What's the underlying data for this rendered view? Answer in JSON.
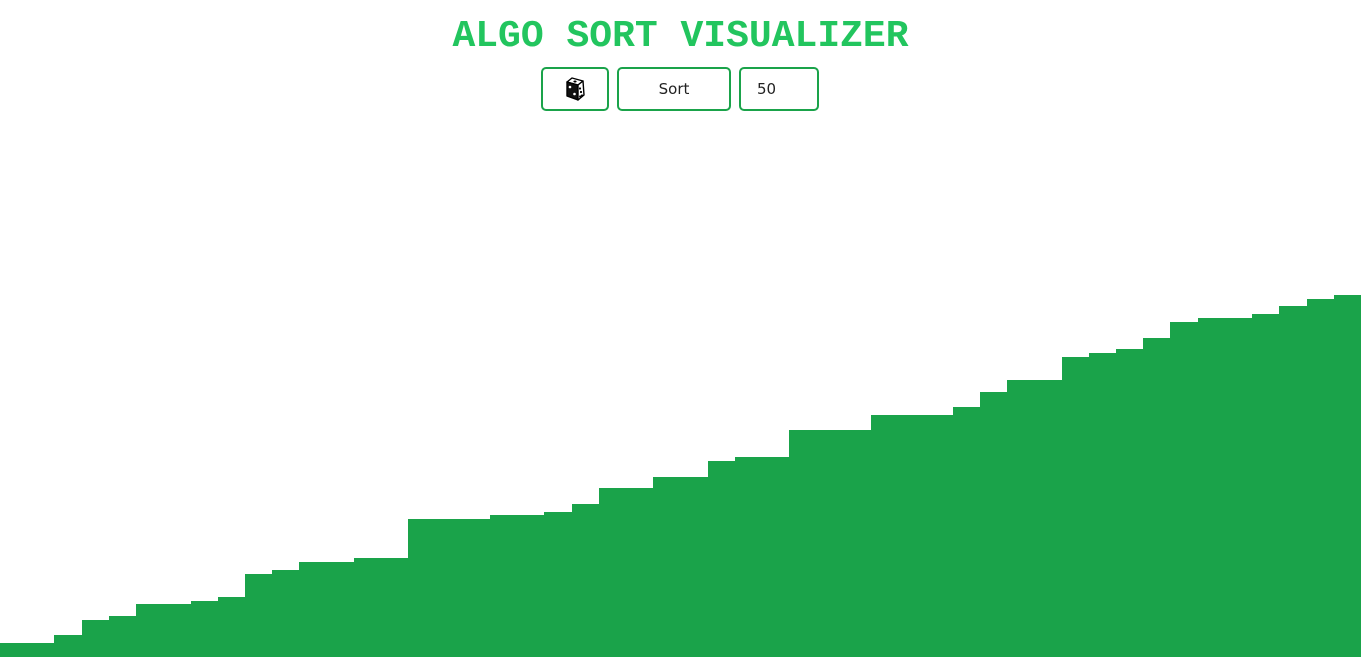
{
  "title": "ALGO SORT VISUALIZER",
  "colors": {
    "accent": "#22c55e",
    "bar": "#1aa34a",
    "border": "#1aa34a"
  },
  "controls": {
    "shuffle_icon": "dice-icon",
    "sort_label": "Sort",
    "size_value": "50"
  },
  "array_values": [
    14,
    14,
    22,
    37,
    41,
    53,
    53,
    56,
    60,
    83,
    87,
    95,
    95,
    99,
    99,
    138,
    138,
    138,
    142,
    142,
    145,
    153,
    169,
    169,
    180,
    180,
    196,
    200,
    200,
    227,
    227,
    227,
    242,
    242,
    242,
    250,
    265,
    277,
    277,
    300,
    304,
    308,
    319,
    335,
    339,
    339,
    343,
    351,
    358,
    362
  ]
}
